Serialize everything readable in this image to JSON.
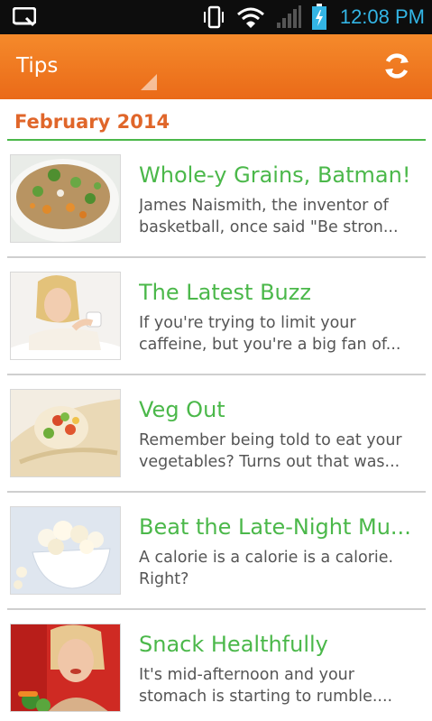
{
  "status_bar": {
    "time": "12:08 PM",
    "icons": [
      "notification-icon",
      "vibrate-icon",
      "wifi-icon",
      "signal-icon",
      "battery-icon"
    ],
    "accent_color": "#33b5e5"
  },
  "action_bar": {
    "title": "Tips",
    "refresh_icon": "refresh-icon",
    "color": "#ee7522"
  },
  "section": {
    "title": "February 2014",
    "title_color": "#e0662a",
    "divider_color": "#4bb84a"
  },
  "tips": [
    {
      "title": "Whole-y Grains, Batman!",
      "desc_line1": "James Naismith, the inventor of",
      "desc_line2": "basketball, once said \"Be stron...",
      "image": "grain-salad-image"
    },
    {
      "title": "The Latest Buzz",
      "desc_line1": "If you're trying to limit your",
      "desc_line2": "caffeine, but you're a big fan of...",
      "image": "woman-coffee-image"
    },
    {
      "title": "Veg Out",
      "desc_line1": "Remember being told to eat your",
      "desc_line2": "vegetables? Turns out that was...",
      "image": "veggie-wrap-image"
    },
    {
      "title": "Beat the Late-Night Mu...",
      "desc_line1": "A calorie is a calorie is a calorie.",
      "desc_line2": "Right?",
      "image": "popcorn-image"
    },
    {
      "title": "Snack Healthfully",
      "desc_line1": "It's mid-afternoon and your",
      "desc_line2": "stomach is starting to rumble....",
      "image": "woman-snack-image"
    }
  ]
}
